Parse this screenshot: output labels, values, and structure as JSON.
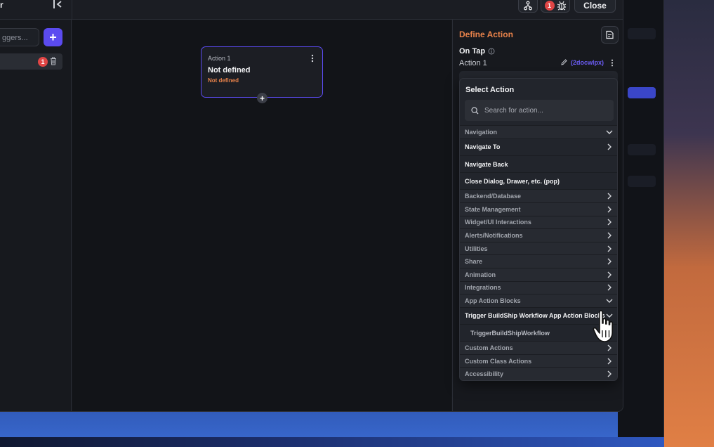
{
  "topbar": {
    "title_fragment": "r",
    "close_label": "Close",
    "debug_badge_count": "1",
    "icons": [
      "collapse-sidebar-icon",
      "git-branch-icon",
      "bug-icon"
    ]
  },
  "sidebar": {
    "search_placeholder": "ggers...",
    "add_label": "+",
    "trigger_badge_count": "1"
  },
  "canvas": {
    "node": {
      "label": "Action 1",
      "name": "Not defined",
      "subtitle": "Not defined",
      "add_label": "+"
    }
  },
  "panel": {
    "title": "Define Action",
    "trigger_label": "On Tap",
    "action_name": "Action 1",
    "action_id": "(2docwlpx)",
    "dropdown": {
      "title": "Select Action",
      "search_placeholder": "Search for action...",
      "rows": [
        {
          "label": "Navigation",
          "kind": "cat",
          "chevron": "down"
        },
        {
          "label": "Navigate To",
          "kind": "item",
          "chevron": "right"
        },
        {
          "label": "Navigate Back",
          "kind": "item",
          "chevron": ""
        },
        {
          "label": "Close Dialog, Drawer, etc. (pop)",
          "kind": "item",
          "chevron": ""
        },
        {
          "label": "Backend/Database",
          "kind": "cat",
          "chevron": "right"
        },
        {
          "label": "State Management",
          "kind": "cat",
          "chevron": "right"
        },
        {
          "label": "Widget/UI Interactions",
          "kind": "cat",
          "chevron": "right"
        },
        {
          "label": "Alerts/Notifications",
          "kind": "cat",
          "chevron": "right"
        },
        {
          "label": "Utilities",
          "kind": "cat",
          "chevron": "right"
        },
        {
          "label": "Share",
          "kind": "cat",
          "chevron": "right"
        },
        {
          "label": "Animation",
          "kind": "cat",
          "chevron": "right"
        },
        {
          "label": "Integrations",
          "kind": "cat",
          "chevron": "right"
        },
        {
          "label": "App Action Blocks",
          "kind": "cat",
          "chevron": "down"
        },
        {
          "label": "Trigger BuildShip Workflow App Action Blocks",
          "kind": "item",
          "chevron": "down"
        },
        {
          "label": "TriggerBuildShipWorkflow",
          "kind": "sub",
          "chevron": ""
        },
        {
          "label": "Custom Actions",
          "kind": "cat",
          "chevron": "right"
        },
        {
          "label": "Custom Class Actions",
          "kind": "cat",
          "chevron": "right"
        },
        {
          "label": "Accessibility",
          "kind": "cat",
          "chevron": "right"
        }
      ]
    }
  },
  "colors": {
    "accent": "#5b4bf0",
    "warning_orange": "#e8824a",
    "badge_red": "#e04545"
  }
}
